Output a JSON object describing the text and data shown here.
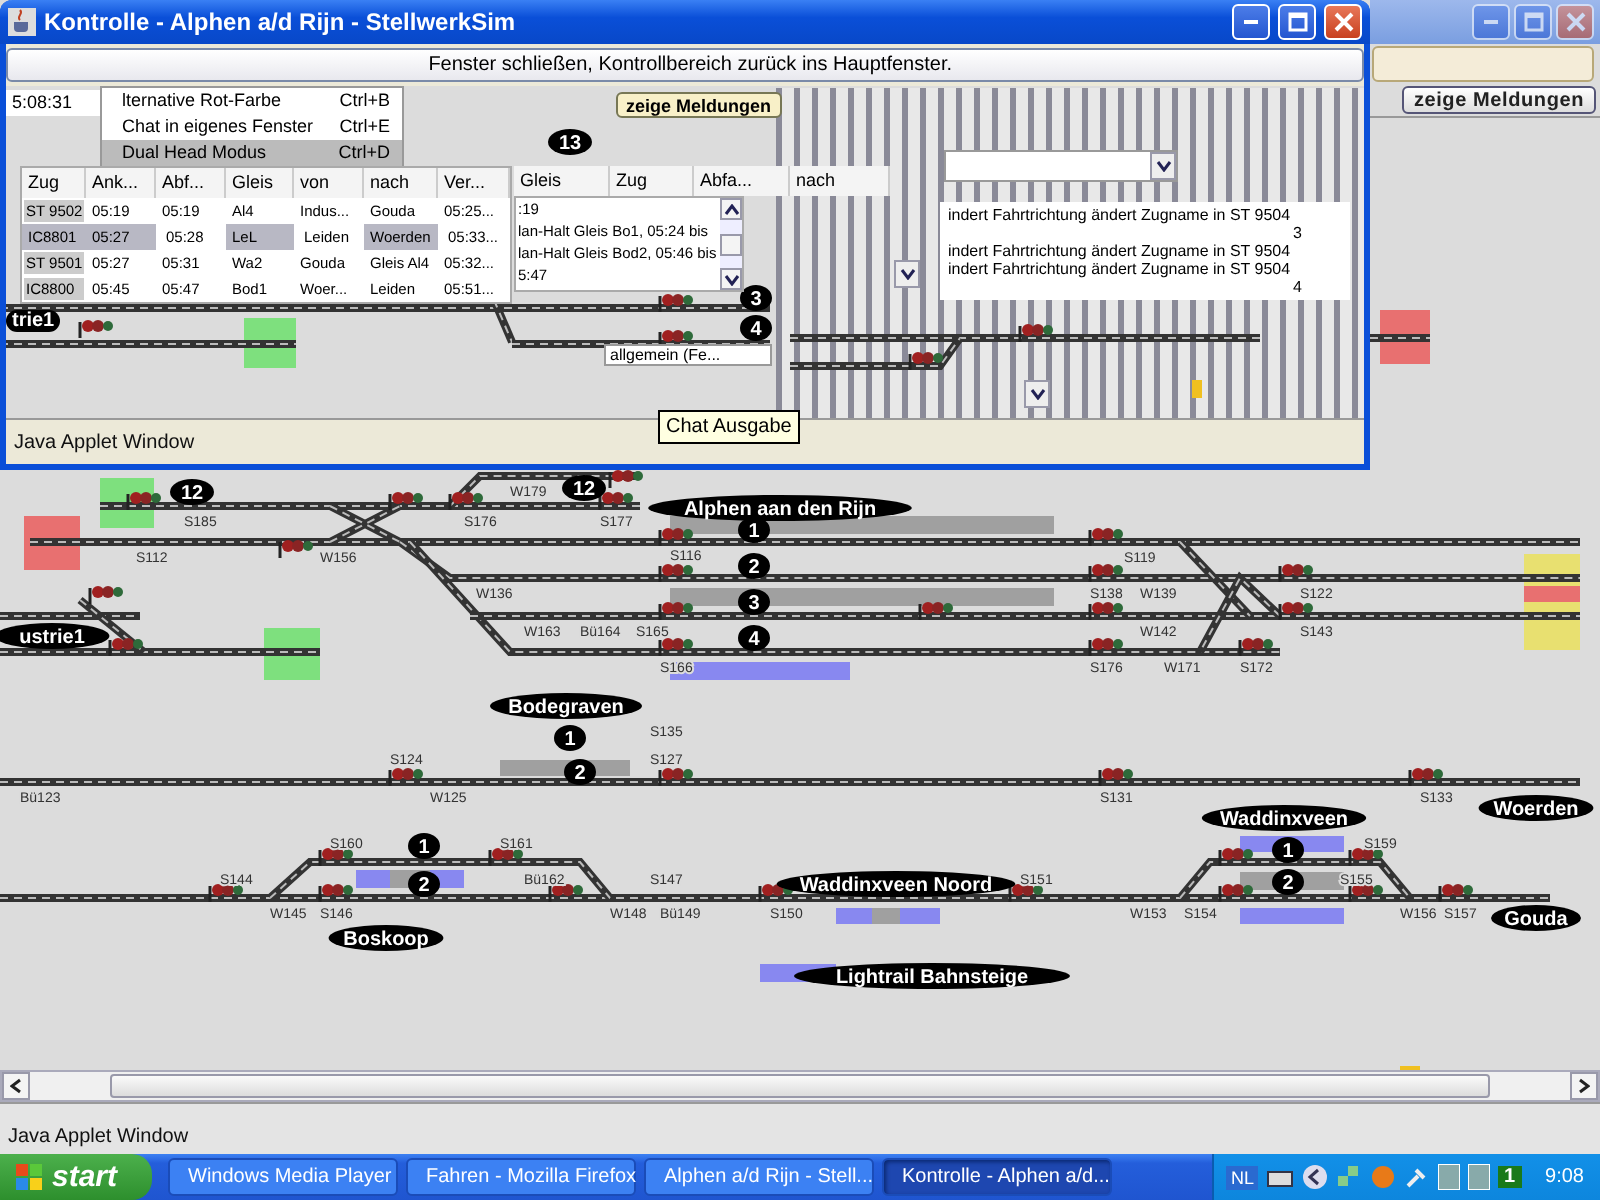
{
  "main_window": {
    "meldungen_button": "zeige Meldungen",
    "status_bar": "Java Applet Window",
    "diagram": {
      "stations": [
        "Alphen aan den Rijn",
        "ustrie1",
        "Bodegraven",
        "Woerden",
        "Waddinxveen",
        "Boskoop",
        "Waddinxveen Noord",
        "Gouda",
        "Lightrail Bahnsteige"
      ],
      "platforms": [
        "12",
        "12",
        "1",
        "2",
        "3",
        "4",
        "1",
        "2",
        "1",
        "2",
        "1",
        "2"
      ],
      "signal_labels": [
        "W179",
        "S185",
        "S176",
        "S177",
        "S112",
        "W156",
        "S116",
        "S119",
        "W136",
        "S138",
        "W139",
        "S122",
        "W163",
        "Bü164",
        "S165",
        "W142",
        "S143",
        "S166",
        "S176",
        "W171",
        "S172",
        "S135",
        "S124",
        "S127",
        "Bü123",
        "W125",
        "S131",
        "S133",
        "S160",
        "S161",
        "S159",
        "S144",
        "Bü162",
        "S147",
        "S151",
        "S155",
        "W145",
        "S146",
        "W148",
        "Bü149",
        "S150",
        "W153",
        "S154",
        "W156",
        "S157"
      ]
    }
  },
  "control_window": {
    "title": "Kontrolle - Alphen a/d Rijn - StellwerkSim",
    "return_button": "Fenster schließen, Kontrollbereich zurück ins Hauptfenster.",
    "clock": "5:08:31",
    "menu": [
      {
        "label": "lternative Rot-Farbe",
        "shortcut": "Ctrl+B",
        "selected": false
      },
      {
        "label": "Chat in eigenes Fenster",
        "shortcut": "Ctrl+E",
        "selected": false
      },
      {
        "label": "Dual Head Modus",
        "shortcut": "Ctrl+D",
        "selected": true
      }
    ],
    "meldungen_button": "zeige Meldungen",
    "station_label": "trie1",
    "platforms": [
      "13",
      "3",
      "4"
    ],
    "timetable": {
      "columns": [
        "Zug",
        "Ank...",
        "Abf...",
        "Gleis",
        "von",
        "nach",
        "Ver..."
      ],
      "rows": [
        {
          "cells": [
            "ST 9502",
            "05:19",
            "05:19",
            "Al4",
            "Indus...",
            "Gouda",
            "05:25..."
          ],
          "selected": false
        },
        {
          "cells": [
            "IC8801",
            "05:27",
            "05:28",
            "LeL",
            "Leiden",
            "Woerden",
            "05:33..."
          ],
          "selected": true
        },
        {
          "cells": [
            "ST 9501",
            "05:27",
            "05:31",
            "Wa2",
            "Gouda",
            "Gleis Al4",
            "05:32..."
          ],
          "selected": false
        },
        {
          "cells": [
            "IC8800",
            "05:45",
            "05:47",
            "Bod1",
            "Woer...",
            "Leiden",
            "05:51..."
          ],
          "selected": false
        }
      ]
    },
    "train_table": {
      "columns": [
        "Gleis",
        "Zug",
        "Abfa...",
        "nach"
      ],
      "lines": [
        ":19",
        "lan-Halt Gleis Bo1, 05:24 bis",
        "lan-Halt Gleis Bod2, 05:46 bis",
        "5:47"
      ]
    },
    "messages": [
      {
        "text": "indert Fahrtrichtung ändert Zugname in ST 9504",
        "kind": "line"
      },
      {
        "text": "3",
        "kind": "count"
      },
      {
        "text": "indert Fahrtrichtung ändert Zugname in ST 9504",
        "kind": "line"
      },
      {
        "text": "indert Fahrtrichtung ändert Zugname in ST 9504",
        "kind": "line"
      },
      {
        "text": "4",
        "kind": "count"
      }
    ],
    "channel_select": "allgemein (Fe...",
    "tooltip": "Chat Ausgabe",
    "status_bar": "Java Applet Window"
  },
  "taskbar": {
    "start": "start",
    "tasks": [
      {
        "label": "Windows Media Player",
        "selected": false
      },
      {
        "label": "Fahren - Mozilla Firefox",
        "selected": false
      },
      {
        "label": "Alphen a/d Rijn - Stell...",
        "selected": false
      },
      {
        "label": "Kontrolle - Alphen a/d...",
        "selected": true
      }
    ],
    "language": "NL",
    "tray_badge": "1",
    "clock": "9:08"
  }
}
